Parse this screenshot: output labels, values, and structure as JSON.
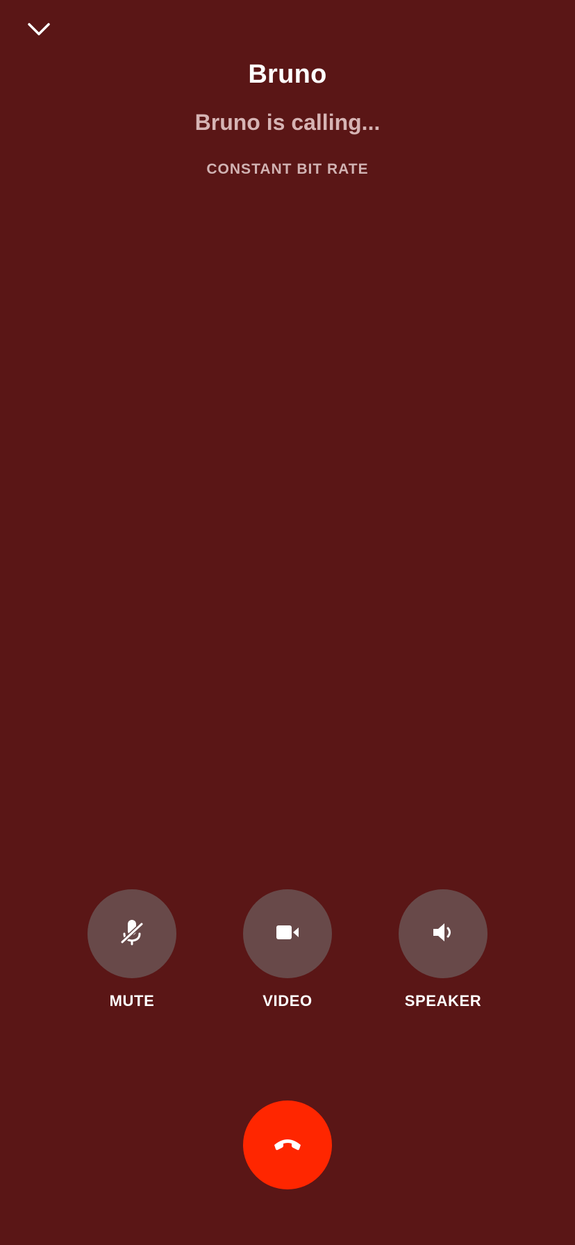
{
  "call": {
    "caller_name": "Bruno",
    "status": "Bruno is calling...",
    "codec_label": "CONSTANT BIT RATE"
  },
  "controls": [
    {
      "label": "MUTE",
      "icon": "mic-off-icon"
    },
    {
      "label": "VIDEO",
      "icon": "video-camera-icon"
    },
    {
      "label": "SPEAKER",
      "icon": "speaker-icon"
    }
  ],
  "hangup": {
    "icon": "phone-hangup-icon"
  },
  "colors": {
    "background": "#5a1616",
    "control_circle": "#684949",
    "hangup": "#ff2600",
    "status_text": "#d6b4b4"
  }
}
